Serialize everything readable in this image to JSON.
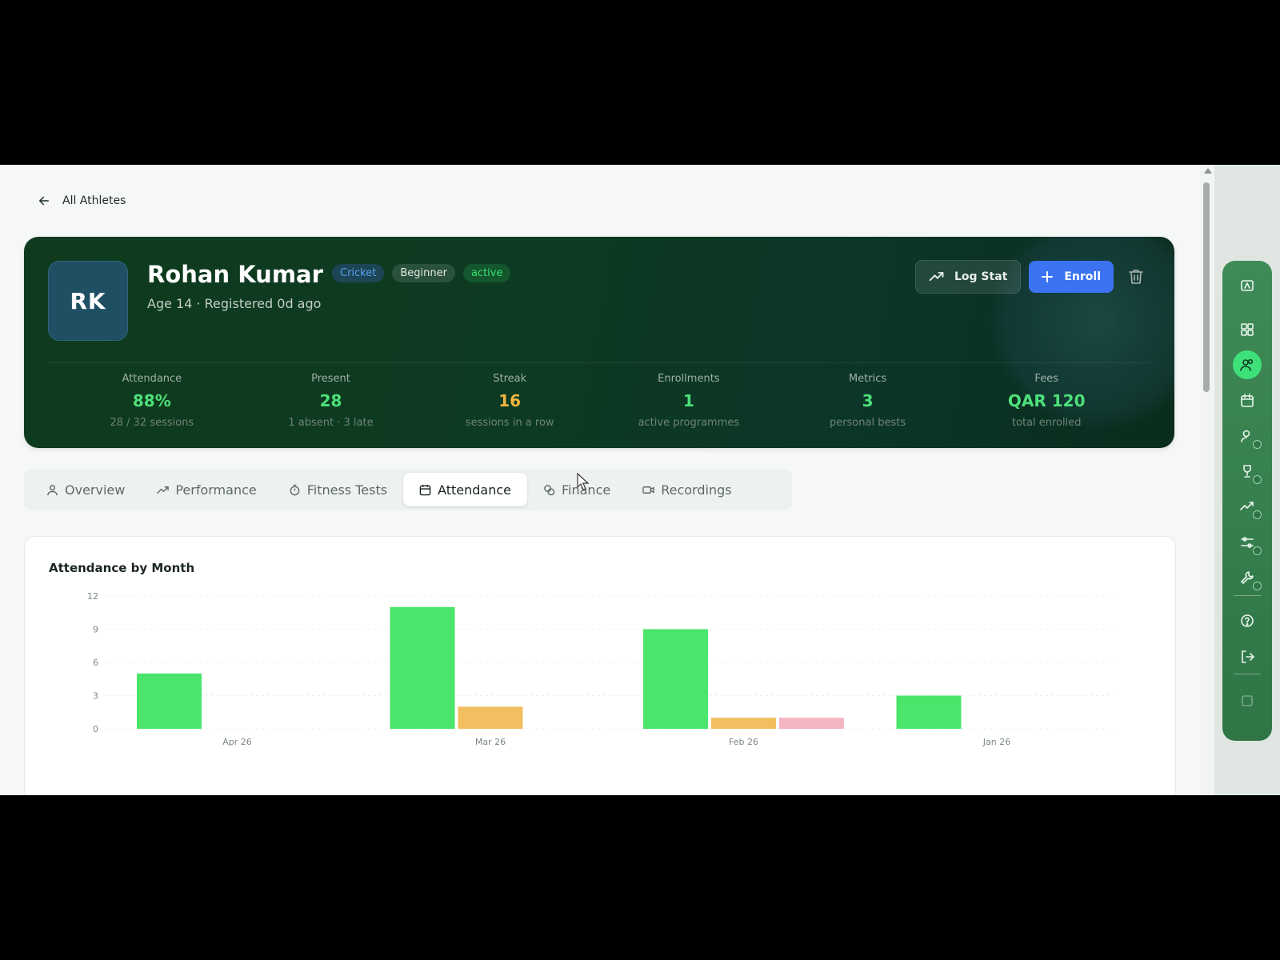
{
  "breadcrumb": {
    "label": "All Athletes"
  },
  "athlete": {
    "initials": "RK",
    "name": "Rohan Kumar",
    "sport": "Cricket",
    "level": "Beginner",
    "status": "active",
    "subtitle": "Age 14 · Registered 0d ago"
  },
  "actions": {
    "log_stat": "Log Stat",
    "enroll": "Enroll"
  },
  "stats": [
    {
      "label": "Attendance",
      "value": "88%",
      "sub": "28 / 32 sessions",
      "color": "#4ee07a"
    },
    {
      "label": "Present",
      "value": "28",
      "sub": "1 absent · 3 late",
      "color": "#4ee07a"
    },
    {
      "label": "Streak",
      "value": "16",
      "sub": "sessions in a row",
      "color": "#f0b541"
    },
    {
      "label": "Enrollments",
      "value": "1",
      "sub": "active programmes",
      "color": "#4ee07a"
    },
    {
      "label": "Metrics",
      "value": "3",
      "sub": "personal bests",
      "color": "#4ee07a"
    },
    {
      "label": "Fees",
      "value": "QAR 120",
      "sub": "total enrolled",
      "color": "#4ee07a"
    }
  ],
  "tabs": [
    {
      "label": "Overview",
      "icon": "user-icon"
    },
    {
      "label": "Performance",
      "icon": "trend-icon"
    },
    {
      "label": "Fitness Tests",
      "icon": "stopwatch-icon"
    },
    {
      "label": "Attendance",
      "icon": "calendar-icon",
      "active": true
    },
    {
      "label": "Finance",
      "icon": "coins-icon"
    },
    {
      "label": "Recordings",
      "icon": "video-icon"
    }
  ],
  "colors": {
    "present": "#4ae56a",
    "late": "#f1bf60",
    "absent": "#f4b6c0"
  },
  "chart_data": {
    "type": "bar",
    "title": "Attendance by Month",
    "categories": [
      "Apr 26",
      "Mar 26",
      "Feb 26",
      "Jan 26"
    ],
    "series": [
      {
        "values": [
          5,
          11,
          9,
          3
        ]
      },
      {
        "values": [
          0,
          2,
          1,
          0
        ]
      },
      {
        "values": [
          0,
          0,
          1,
          0
        ]
      }
    ],
    "yticks": [
      "0",
      "3",
      "6",
      "9",
      "12"
    ],
    "ylim": [
      0,
      12
    ],
    "grid": true
  },
  "rail": [
    "dashboard-icon",
    "grid-icon",
    "athletes-icon",
    "calendar-icon",
    "coach-icon",
    "trophy-icon",
    "trend-icon",
    "sliders-icon",
    "tools-icon",
    "help-icon",
    "logout-icon",
    "panel-icon"
  ]
}
